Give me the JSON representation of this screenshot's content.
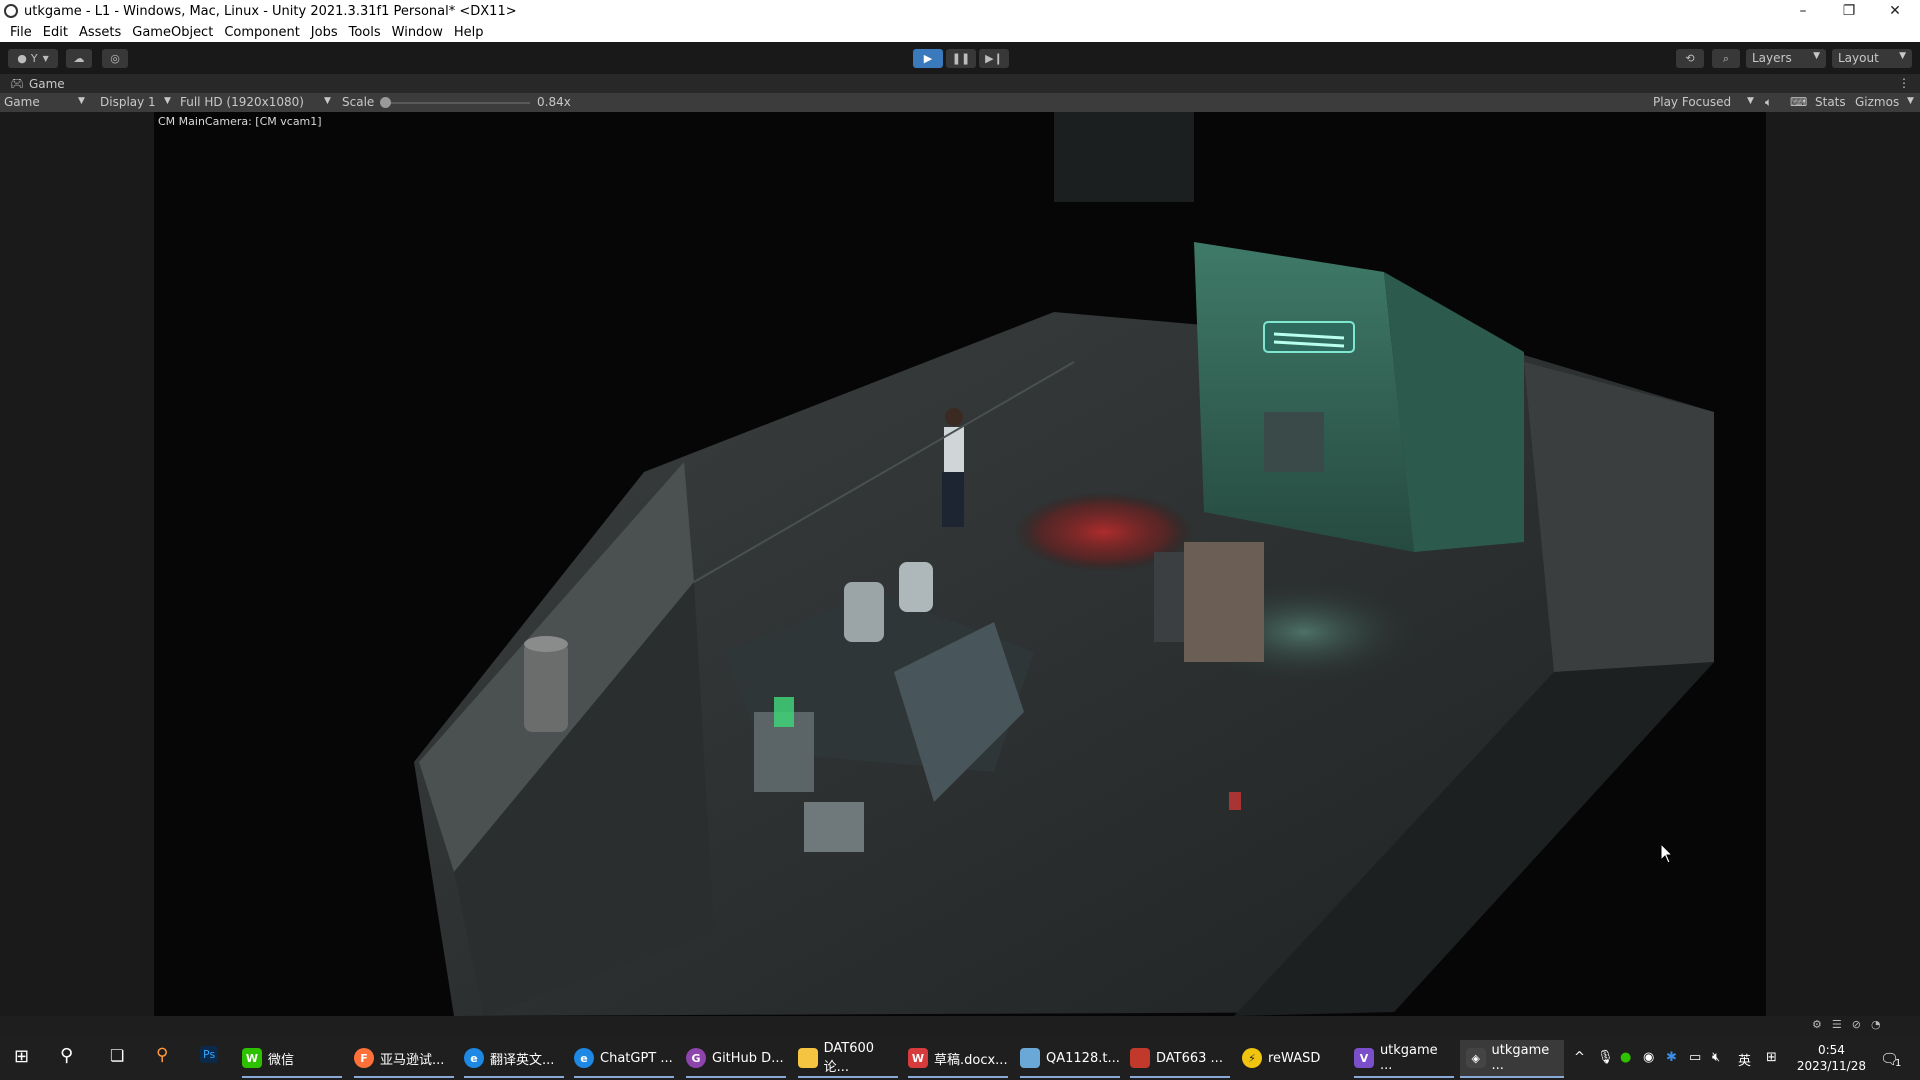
{
  "window": {
    "title": "utkgame - L1 - Windows, Mac, Linux - Unity 2021.3.31f1 Personal* <DX11>",
    "controls": {
      "minimize": "–",
      "restore": "❐",
      "close": "✕"
    }
  },
  "menu": [
    "File",
    "Edit",
    "Assets",
    "GameObject",
    "Component",
    "Jobs",
    "Tools",
    "Window",
    "Help"
  ],
  "toolbar": {
    "account_label": "Y",
    "play_icon": "play-icon",
    "pause_icon": "pause-icon",
    "step_icon": "step-icon",
    "layers_label": "Layers",
    "layout_label": "Layout"
  },
  "game_tab": {
    "label": "Game"
  },
  "game_toolbar": {
    "view_mode": "Game",
    "display": "Display 1",
    "resolution": "Full HD (1920x1080)",
    "scale_label": "Scale",
    "scale_value": "0.84x",
    "scale_fraction": 0.0,
    "play_mode": "Play Focused",
    "stats_label": "Stats",
    "gizmos_label": "Gizmos"
  },
  "viewport": {
    "camera_label": "CM MainCamera: [CM vcam1]"
  },
  "taskbar": {
    "items": [
      {
        "label": "微信",
        "icon": "wechat-icon",
        "color": "#2dc100"
      },
      {
        "label": "亚马逊试...",
        "icon": "firefox-icon",
        "color": "#ff7139"
      },
      {
        "label": "翻译英文...",
        "icon": "edge-icon",
        "color": "#1e88e5"
      },
      {
        "label": "ChatGPT ...",
        "icon": "edge-icon",
        "color": "#1e88e5"
      },
      {
        "label": "GitHub D...",
        "icon": "github-desktop-icon",
        "color": "#8e44ad"
      },
      {
        "label": "DAT600论...",
        "icon": "folder-icon",
        "color": "#f5c542"
      },
      {
        "label": "草稿.docx...",
        "icon": "wps-icon",
        "color": "#d83b3b"
      },
      {
        "label": "QA1128.t...",
        "icon": "notepad-icon",
        "color": "#6aa8d8"
      },
      {
        "label": "DAT663 ...",
        "icon": "document-icon",
        "color": "#c0392b"
      },
      {
        "label": "reWASD",
        "icon": "rewasd-icon",
        "color": "#f1c40f"
      },
      {
        "label": "utkgame ...",
        "icon": "visual-studio-icon",
        "color": "#7b4fc9"
      },
      {
        "label": "utkgame ...",
        "icon": "unity-icon",
        "color": "#444444"
      }
    ],
    "ime_label": "英",
    "time": "0:54",
    "date": "2023/11/28",
    "notification_count": "1"
  }
}
